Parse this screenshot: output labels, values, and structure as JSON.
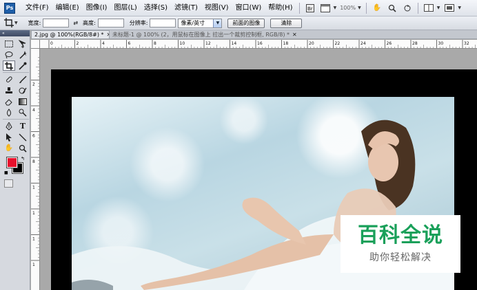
{
  "app": {
    "logo": "Ps"
  },
  "menu": {
    "items": [
      "文件(F)",
      "编辑(E)",
      "图像(I)",
      "图层(L)",
      "选择(S)",
      "滤镜(T)",
      "视图(V)",
      "窗口(W)",
      "帮助(H)"
    ],
    "zoom": "100%"
  },
  "options": {
    "width_label": "宽度:",
    "height_label": "高度:",
    "resolution_label": "分辨率:",
    "unit_value": "像素/英寸",
    "front_image_button": "前面的图像",
    "clear_button": "清除"
  },
  "tabs": [
    {
      "label": "2.jpg @ 100%(RGB/8#) *",
      "active": true
    },
    {
      "label": "未标题-1 @ 100% (2，用鼠标在图像上 拉出一个裁剪控制框, RGB/8) *",
      "active": false
    }
  ],
  "rulers": {
    "top": [
      "0",
      "2",
      "4",
      "6",
      "8",
      "10",
      "12",
      "14",
      "16",
      "18",
      "20",
      "22",
      "24",
      "26",
      "28",
      "30",
      "32"
    ],
    "left": [
      "2",
      "4",
      "6",
      "8",
      "1",
      "1",
      "1",
      "1"
    ]
  },
  "toolbox": {
    "tools": [
      "marquee-icon",
      "move-icon",
      "lasso-icon",
      "magic-wand-icon",
      "crop-icon",
      "eyedropper-icon",
      "healing-icon",
      "brush-icon",
      "stamp-icon",
      "history-brush-icon",
      "eraser-icon",
      "gradient-icon",
      "blur-icon",
      "dodge-icon",
      "pen-icon",
      "type-icon",
      "path-select-icon",
      "line-icon",
      "hand-icon",
      "zoom-icon"
    ],
    "foreground_color": "#e8112d",
    "background_color": "#000000"
  },
  "watermark": {
    "title": "百科全说",
    "subtitle": "助你轻松解决",
    "color": "#1aa05a"
  }
}
